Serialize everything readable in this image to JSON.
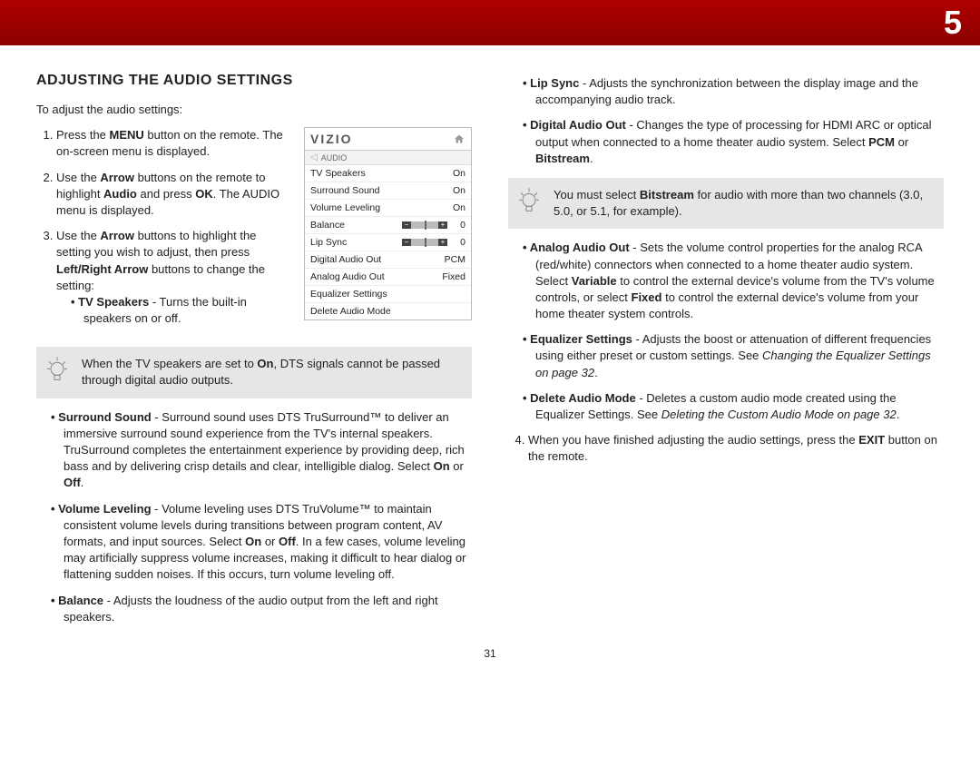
{
  "chapter": "5",
  "h2": "ADJUSTING THE AUDIO SETTINGS",
  "intro": "To adjust the audio settings:",
  "steps": {
    "s1a": "Press the ",
    "s1b": "MENU",
    "s1c": " button on the remote. The on-screen menu is displayed.",
    "s2a": "Use the ",
    "s2b": "Arrow",
    "s2c": " buttons on the remote to highlight ",
    "s2d": "Audio",
    "s2e": " and press ",
    "s2f": "OK",
    "s2g": ". The AUDIO menu is displayed.",
    "s3a": "Use the ",
    "s3b": "Arrow",
    "s3c": " buttons to highlight the setting you wish to adjust, then press ",
    "s3d": "Left/Right Arrow",
    "s3e": " buttons to change the setting:",
    "s4a": "When you have finished adjusting the audio settings, press the ",
    "s4b": "EXIT",
    "s4c": " button on the remote."
  },
  "bullets": {
    "tvspk_t": "TV Speakers",
    "tvspk_b": " - Turns the built-in speakers on or off.",
    "surr_t": "Surround Sound",
    "surr_b": " - Surround sound uses DTS TruSurround™ to deliver an immersive surround sound experience from the TV's internal speakers. TruSurround completes the entertainment experience by providing deep, rich bass and by delivering crisp details and clear, intelligible dialog. Select ",
    "surr_on": "On",
    "surr_or": " or ",
    "surr_off": "Off",
    "dot": ".",
    "vl_t": "Volume Leveling",
    "vl_b1": " - Volume leveling uses DTS TruVolume™ to maintain consistent volume levels during transitions between program content, AV formats, and input sources. Select ",
    "vl_on": "On",
    "vl_or": " or ",
    "vl_off": "Off",
    "vl_b2": ". In a few cases, volume leveling may artificially suppress volume increases, making it difficult to hear dialog or flattening sudden noises. If this occurs, turn volume leveling off.",
    "bal_t": "Balance",
    "bal_b": " - Adjusts the loudness of the audio output from the left and right speakers.",
    "lip_t": "Lip Sync",
    "lip_b": " - Adjusts the synchronization between the display image and the accompanying audio track.",
    "dao_t": "Digital Audio Out",
    "dao_b1": " - Changes the type of processing for HDMI ARC or optical output when connected to a home theater audio system. Select ",
    "dao_pcm": "PCM",
    "dao_or": " or ",
    "dao_bs": "Bitstream",
    "aao_t": "Analog Audio Out",
    "aao_b1": " - Sets the volume control properties for the analog RCA (red/white) connectors when connected to a home theater audio system. Select ",
    "aao_var": "Variable",
    "aao_b2": " to control the external device's volume from the TV's volume controls, or select ",
    "aao_fix": "Fixed",
    "aao_b3": " to control the external device's volume from your home theater system controls.",
    "eq_t": "Equalizer Settings",
    "eq_b1": " - Adjusts the boost or attenuation of different frequencies using either preset or custom settings. See ",
    "eq_i": "Changing the Equalizer Settings on page 32",
    "del_t": "Delete Audio Mode",
    "del_b1": " - Deletes a custom audio mode created using the Equalizer Settings. See ",
    "del_i": "Deleting the Custom Audio Mode on page 32"
  },
  "note1a": "When the TV speakers are set to ",
  "note1b": "On",
  "note1c": ", DTS signals cannot be passed through digital audio outputs.",
  "note2a": "You must select ",
  "note2b": "Bitstream",
  "note2c": " for audio with more than two channels (3.0, 5.0, or 5.1, for example).",
  "menu": {
    "brand": "VIZIO",
    "crumb": "AUDIO",
    "rows": [
      {
        "label": "TV Speakers",
        "value": "On",
        "type": "text"
      },
      {
        "label": "Surround Sound",
        "value": "On",
        "type": "text"
      },
      {
        "label": "Volume Leveling",
        "value": "On",
        "type": "text"
      },
      {
        "label": "Balance",
        "value": "0",
        "type": "slider"
      },
      {
        "label": "Lip Sync",
        "value": "0",
        "type": "slider"
      },
      {
        "label": "Digital Audio Out",
        "value": "PCM",
        "type": "text"
      },
      {
        "label": "Analog Audio Out",
        "value": "Fixed",
        "type": "text"
      },
      {
        "label": "Equalizer Settings",
        "value": "",
        "type": "text"
      },
      {
        "label": "Delete Audio Mode",
        "value": "",
        "type": "text"
      }
    ]
  },
  "pagenum": "31"
}
